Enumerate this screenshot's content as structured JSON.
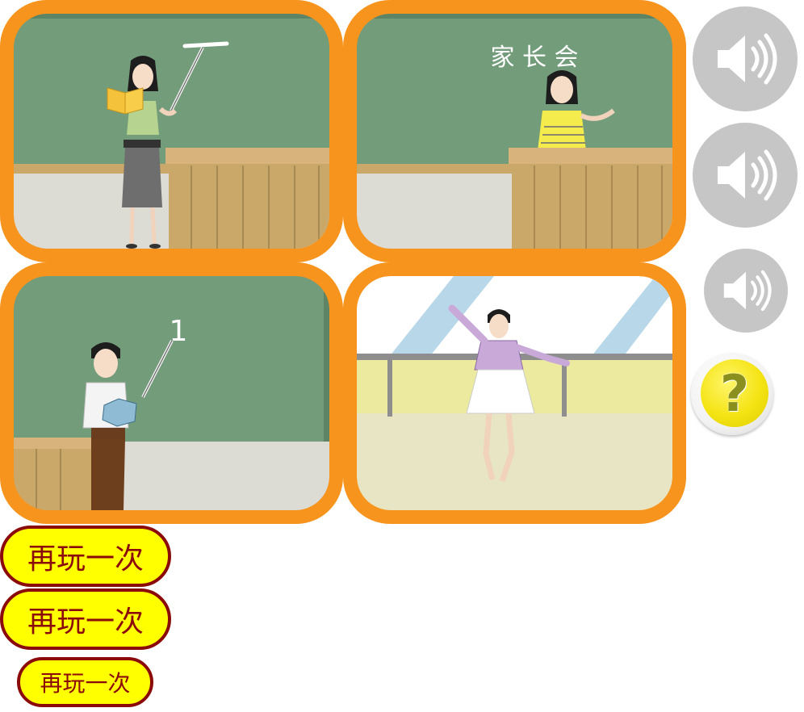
{
  "scenes": [
    {
      "name": "teacher-reading-with-pointer",
      "board_text": "一"
    },
    {
      "name": "parent-meeting",
      "board_text": "家 长 会"
    },
    {
      "name": "math-teacher",
      "board_text": "1"
    },
    {
      "name": "dancer-at-barre",
      "board_text": ""
    }
  ],
  "audio_buttons": [
    {
      "icon": "speaker-icon"
    },
    {
      "icon": "speaker-icon"
    },
    {
      "icon": "speaker-icon"
    }
  ],
  "help": {
    "icon": "question-mark-icon",
    "glyph": "?"
  },
  "replay_buttons": [
    {
      "label": "再玩一次"
    },
    {
      "label": "再玩一次"
    },
    {
      "label": "再玩一次"
    }
  ],
  "colors": {
    "card_border": "#f7941d",
    "chalkboard": "#739c7b",
    "replay_bg": "#ffff00",
    "replay_text": "#8b0a0a",
    "speaker_bg": "#c6c6c6"
  }
}
